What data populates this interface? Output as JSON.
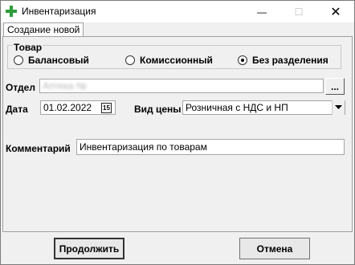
{
  "window": {
    "title": "Инвентаризация",
    "controls": {
      "minimize": "—",
      "maximize": "☐",
      "close": "✕"
    }
  },
  "tab": {
    "label": "Создание новой"
  },
  "goods_group": {
    "legend": "Товар",
    "options": [
      {
        "label": "Балансовый",
        "selected": false
      },
      {
        "label": "Комиссионный",
        "selected": false
      },
      {
        "label": "Без разделения",
        "selected": true
      }
    ]
  },
  "department": {
    "label": "Отдел",
    "value": "Аптека №",
    "browse_label": "..."
  },
  "date": {
    "label": "Дата",
    "value": "01.02.2022",
    "calendar_glyph": "15"
  },
  "price_type": {
    "label": "Вид цены",
    "value": "Розничная с НДС и НП"
  },
  "comment": {
    "label": "Комментарий",
    "value": "Инвентаризация по товарам"
  },
  "buttons": {
    "continue": "Продолжить",
    "cancel": "Отмена"
  },
  "colors": {
    "app_icon": "#2e9d3a"
  }
}
